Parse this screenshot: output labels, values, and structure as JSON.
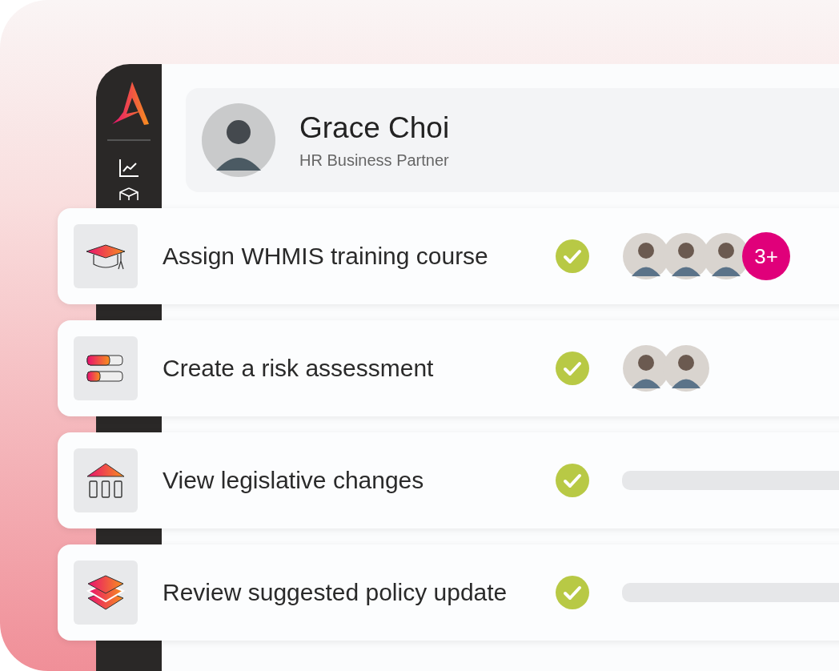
{
  "profile": {
    "name": "Grace Choi",
    "role": "HR Business Partner"
  },
  "tasks": [
    {
      "kind": "graduation-cap",
      "title": "Assign WHMIS training course",
      "done": true,
      "people": [
        {
          "kind": "photo"
        },
        {
          "kind": "photo"
        },
        {
          "kind": "photo"
        }
      ],
      "more": "3+"
    },
    {
      "kind": "progress-bars",
      "title": "Create a risk assessment",
      "done": true,
      "people": [
        {
          "kind": "photo"
        },
        {
          "kind": "photo"
        }
      ]
    },
    {
      "kind": "building",
      "title": "View legislative changes",
      "done": true,
      "placeholder": true
    },
    {
      "kind": "layers",
      "title": "Review suggested policy update",
      "done": true,
      "placeholder": true
    }
  ]
}
